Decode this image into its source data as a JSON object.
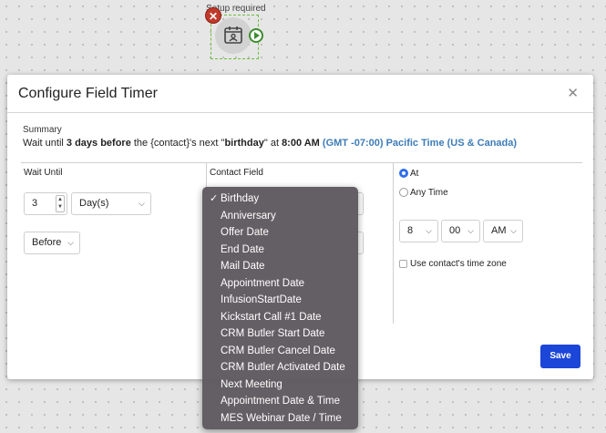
{
  "canvas": {
    "node_label": "Setup required",
    "error_glyph": "✕",
    "icons": {
      "node": "calendar-person-icon",
      "error": "error-badge-icon",
      "run": "play-circle-icon"
    }
  },
  "modal": {
    "title": "Configure Field Timer",
    "close_glyph": "✕",
    "summary": {
      "label": "Summary",
      "prefix": "Wait until ",
      "offset": "3 days before",
      "middle": " the {contact}'s next \"",
      "field": "birthday",
      "at_word": "\" at ",
      "time": "8:00 AM",
      "timezone": "(GMT -07:00) Pacific Time (US & Canada)"
    },
    "wait_until": {
      "heading": "Wait Until",
      "amount": "3",
      "unit": "Day(s)",
      "direction": "Before"
    },
    "contact_field": {
      "heading": "Contact Field",
      "options": [
        "Birthday",
        "Anniversary",
        "Offer Date",
        "End Date",
        "Mail Date",
        "Appointment Date",
        "InfusionStartDate",
        "Kickstart Call #1 Date",
        "CRM Butler Start Date",
        "CRM Butler Cancel Date",
        "CRM Butler Activated Date",
        "Next Meeting",
        "Appointment Date & Time",
        "MES Webinar Date / Time"
      ],
      "selected": "Birthday",
      "check_glyph": "✓"
    },
    "time": {
      "at_label": "At",
      "any_time_label": "Any Time",
      "hour": "8",
      "minute": "00",
      "meridiem": "AM",
      "use_contact_tz_label": "Use contact's time zone"
    },
    "save_label": "Save",
    "colors": {
      "primary": "#1c46d7",
      "link": "#3d7cb8",
      "radio": "#2f6ff0"
    }
  }
}
